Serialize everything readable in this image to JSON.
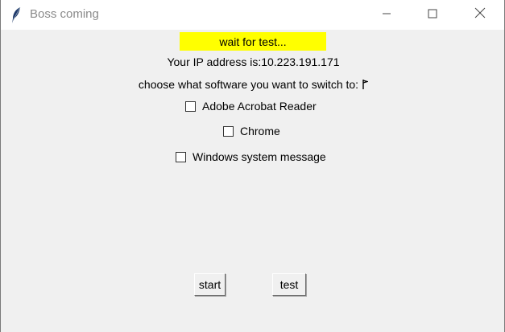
{
  "window": {
    "title": "Boss coming",
    "icon": "feather-icon",
    "controls": {
      "minimize": "minimize-icon",
      "maximize": "maximize-icon",
      "close": "close-icon"
    }
  },
  "status": {
    "text": "wait for test...",
    "background": "#ffff00"
  },
  "ip_label": "Your IP address is:10.223.191.171",
  "choose_label": "choose what software you want to switch to:",
  "options": [
    {
      "label": "Adobe Acrobat Reader",
      "checked": false
    },
    {
      "label": "Chrome",
      "checked": false
    },
    {
      "label": "Windows system message",
      "checked": false
    }
  ],
  "buttons": {
    "start": "start",
    "test": "test"
  }
}
